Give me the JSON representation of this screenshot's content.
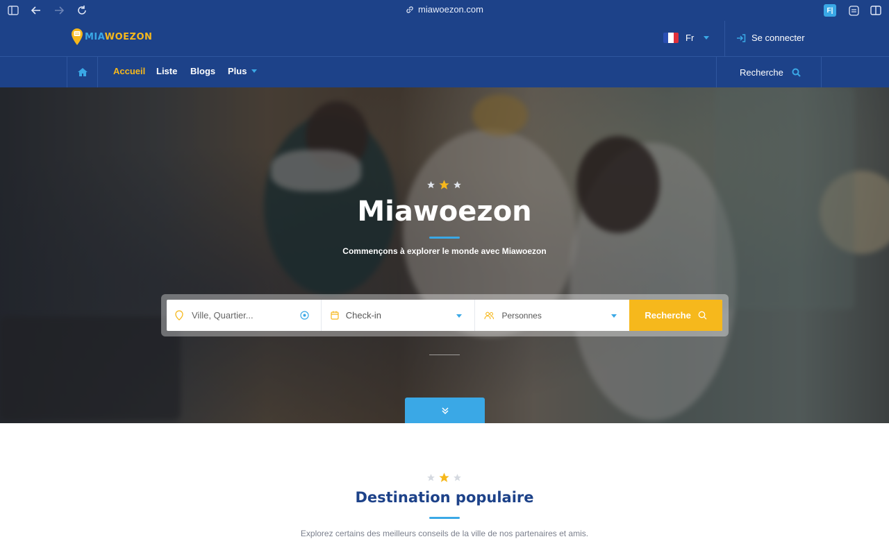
{
  "browser": {
    "url": "miawoezon.com",
    "extension_label": "F|"
  },
  "brand": {
    "name_part1": "MIA",
    "name_part2": "WOEZON",
    "color_primary": "#1d4289",
    "color_accent": "#f6b81c",
    "color_light_blue": "#3aa8e6"
  },
  "header": {
    "language": "Fr",
    "login_label": "Se connecter"
  },
  "nav": {
    "items": [
      {
        "label": "Accueil",
        "active": true
      },
      {
        "label": "Liste",
        "active": false
      },
      {
        "label": "Blogs",
        "active": false
      },
      {
        "label": "Plus",
        "active": false
      }
    ],
    "search_label": "Recherche"
  },
  "hero": {
    "title": "Miawoezon",
    "subtitle": "Commençons à explorer le monde avec Miawoezon",
    "search": {
      "location_placeholder": "Ville, Quartier...",
      "checkin_label": "Check-in",
      "persons_label": "Personnes",
      "button_label": "Recherche"
    }
  },
  "section": {
    "title": "Destination populaire",
    "subtitle": "Explorez certains des meilleurs conseils de la ville de nos partenaires et amis."
  }
}
